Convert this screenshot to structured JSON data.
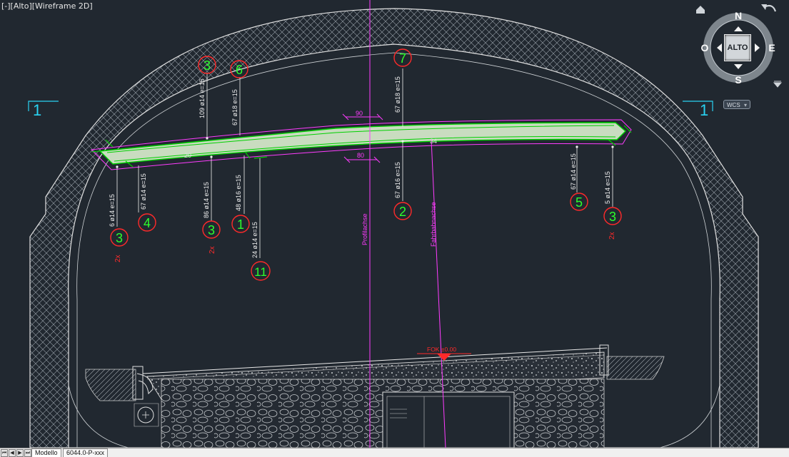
{
  "viewport": {
    "label": "[-][Alto][Wireframe 2D]"
  },
  "viewcube": {
    "face": "ALTO",
    "north": "N",
    "south": "S",
    "east": "E",
    "west": "O",
    "home_icon": "home-icon",
    "rotate_icon": "rotate-arrow-icon",
    "menu_icon": "viewcube-menu-icon",
    "wcs_label": "WCS"
  },
  "section_marks": {
    "left": "1",
    "right": "1"
  },
  "axes": {
    "profile": "Profilachse",
    "track": "Fahrbahnachse"
  },
  "elevation": {
    "label": "FOK ±0.00"
  },
  "dimensions": {
    "top": "90",
    "bottom": "80",
    "left": "20",
    "right": "34"
  },
  "rebars": [
    {
      "id": "1",
      "text": "48 ø16 e=15",
      "prefix": ""
    },
    {
      "id": "2",
      "text": "67 ø16 e=15",
      "prefix": ""
    },
    {
      "id": "3",
      "text": "6 ø14 e=15",
      "prefix": "2x"
    },
    {
      "id": "3",
      "text": "109 ø14 e=15",
      "prefix": ""
    },
    {
      "id": "3",
      "text": "86 ø14 e=15",
      "prefix": "2x"
    },
    {
      "id": "3",
      "text": "5 ø14 e=15",
      "prefix": "2x"
    },
    {
      "id": "4",
      "text": "67 ø14 e=15",
      "prefix": ""
    },
    {
      "id": "5",
      "text": "67 ø14 e=15",
      "prefix": ""
    },
    {
      "id": "6",
      "text": "67 ø18 e=15",
      "prefix": ""
    },
    {
      "id": "7",
      "text": "67 ø18 e=15",
      "prefix": ""
    },
    {
      "id": "11",
      "text": "24 ø14 e=15",
      "prefix": ""
    }
  ],
  "layout_tabs": {
    "model": "Modello",
    "sheet": "6044.0-P-xxx"
  },
  "colors": {
    "background": "#212830",
    "structure": "#d9d9d9",
    "axis": "#ff3cff",
    "rebar": "#00d000",
    "rebar_label": "#ff2a2a",
    "slab_fill": "#c9dcc0",
    "cyan_mark": "#29d3f2"
  }
}
